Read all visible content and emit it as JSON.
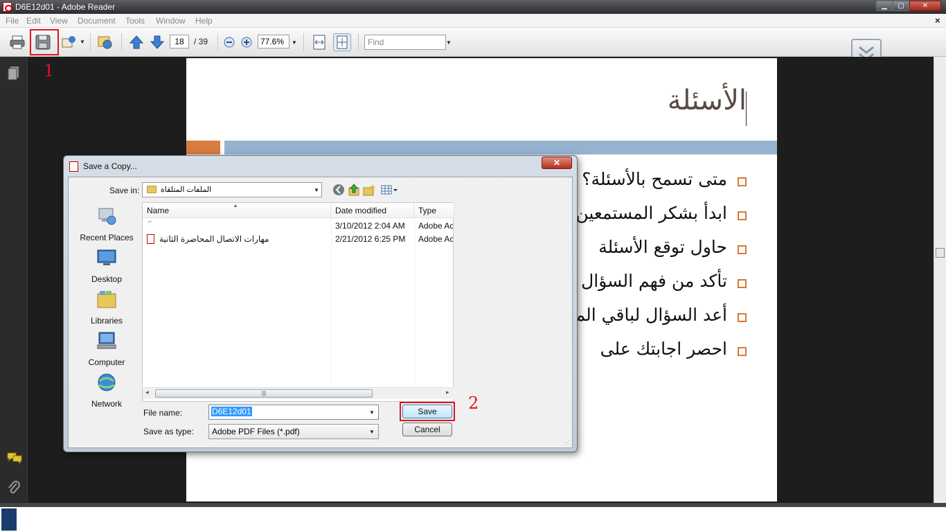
{
  "window": {
    "title": "D6E12d01 - Adobe Reader",
    "min_glyph": "▁",
    "max_glyph": "▢",
    "close_glyph": "✕"
  },
  "menu": {
    "items": [
      "File",
      "Edit",
      "View",
      "Document",
      "Tools",
      "Window",
      "Help"
    ],
    "close_doc": "×"
  },
  "toolbar": {
    "page_current": "18",
    "page_total": "/ 39",
    "zoom": "77.6%",
    "find_placeholder": "Find"
  },
  "annotations": {
    "label_1": "1",
    "label_2": "2",
    "color": "#e0141e"
  },
  "slide": {
    "title": "الأسئلة",
    "bullets": [
      "متى تسمح بالأسئلة؟",
      "ابدأ بشكر المستمعين",
      "حاول توقع الأسئلة",
      "تأكد من فهم السؤال",
      "أعد السؤال لباقي المستمعين",
      "احصر اجابتك على"
    ],
    "accent_orange": "#d87b3f",
    "accent_blue": "#95b3d0"
  },
  "dialog": {
    "title": "Save a Copy...",
    "close_glyph": "✕",
    "save_in_label": "Save in:",
    "save_in_value": "الملفات المتلقاة",
    "places": [
      {
        "label": "Recent Places",
        "icon": "recent-places-icon"
      },
      {
        "label": "Desktop",
        "icon": "desktop-icon"
      },
      {
        "label": "Libraries",
        "icon": "libraries-icon"
      },
      {
        "label": "Computer",
        "icon": "computer-icon"
      },
      {
        "label": "Network",
        "icon": "network-icon"
      }
    ],
    "columns": {
      "name": "Name",
      "date": "Date modified",
      "type": "Type"
    },
    "files": [
      {
        "name": "",
        "date": "3/10/2012 2:04 AM",
        "type": "Adobe Ac"
      },
      {
        "name": "مهارات الاتصال المحاضرة الثانية",
        "date": "2/21/2012 6:25 PM",
        "type": "Adobe Ac"
      }
    ],
    "file_name_label": "File name:",
    "file_name_value": "D6E12d01",
    "save_as_type_label": "Save as type:",
    "save_as_type_value": "Adobe PDF Files (*.pdf)",
    "save_label": "Save",
    "cancel_label": "Cancel"
  }
}
